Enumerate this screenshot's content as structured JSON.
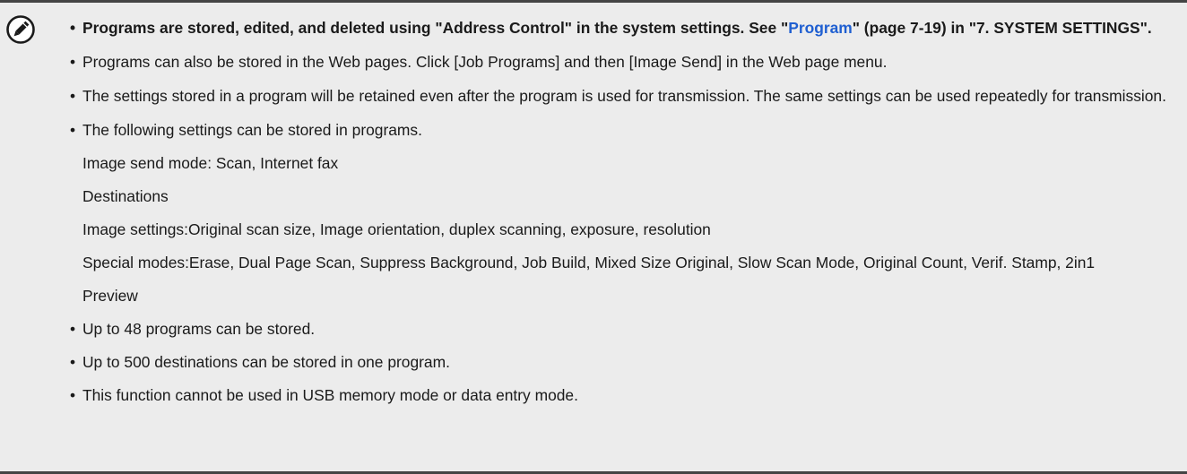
{
  "note": {
    "items": {
      "0": {
        "part1": "Programs are stored, edited, and deleted using \"Address Control\" in the system settings. See \"",
        "link": "Program",
        "part2": "\" (page 7-19) in \"7. SYSTEM SETTINGS\"."
      },
      "1": {
        "text": "Programs can also be stored in the Web pages. Click [Job Programs] and then [Image Send] in the Web page menu."
      },
      "2": {
        "text": "The settings stored in a program will be retained even after the program is used for transmission. The same settings can be used repeatedly for transmission."
      },
      "3": {
        "text": "The following settings can be stored in programs."
      },
      "4": {
        "text": "Up to 48 programs can be stored."
      },
      "5": {
        "text": "Up to 500 destinations can be stored in one program."
      },
      "6": {
        "text": "This function cannot be used in USB memory mode or data entry mode."
      }
    },
    "settings": {
      "send_mode": "Image send mode: Scan, Internet fax",
      "destinations": "Destinations",
      "image_term": "Image settings: ",
      "image_desc": "Original scan size, Image orientation, duplex scanning, exposure, resolution",
      "special_term": "Special modes: ",
      "special_desc": "Erase, Dual Page Scan, Suppress Background, Job Build, Mixed Size Original, Slow Scan Mode, Original Count, Verif. Stamp, 2in1",
      "preview": "Preview"
    }
  },
  "colors": {
    "background": "#ececec",
    "border": "#444444",
    "link": "#1f5fd1",
    "icon": "#1a1a1a"
  },
  "icons": {
    "note": "pencil-note-icon"
  }
}
